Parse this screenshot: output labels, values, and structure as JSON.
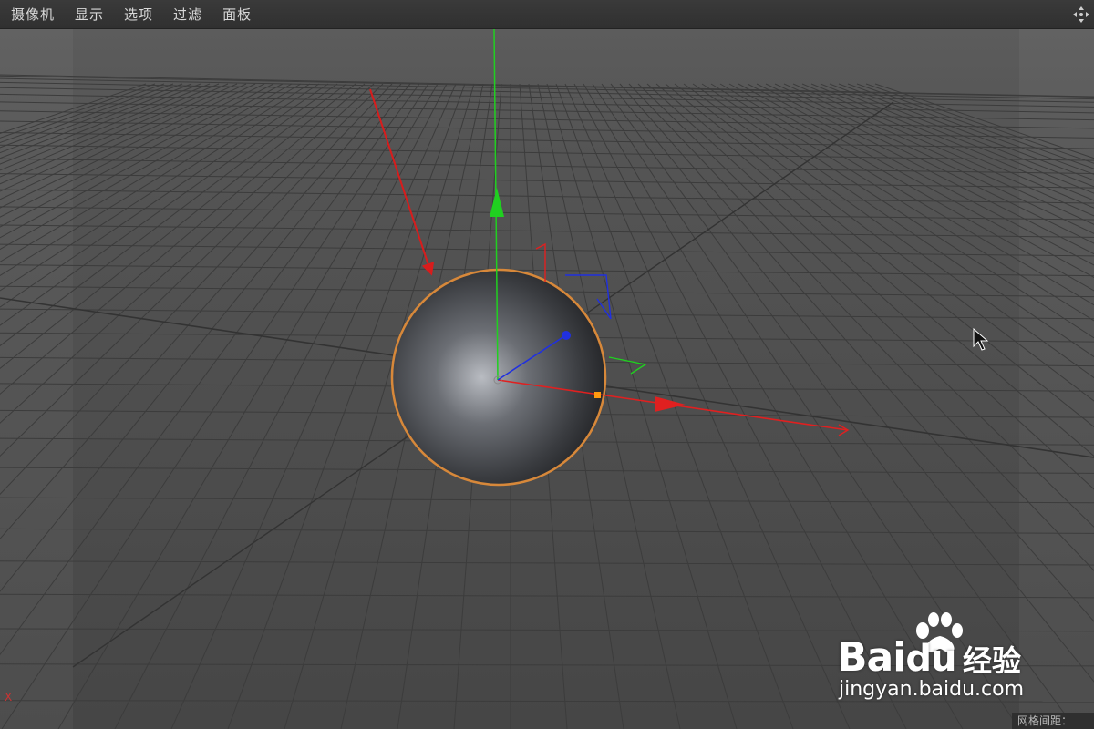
{
  "menubar": {
    "items": [
      {
        "label": "摄像机"
      },
      {
        "label": "显示"
      },
      {
        "label": "选项"
      },
      {
        "label": "过滤"
      },
      {
        "label": "面板"
      }
    ],
    "nav_icon": "move-view-icon"
  },
  "viewport": {
    "object": "sphere",
    "axes": {
      "x_color": "#e02020",
      "y_color": "#20d020",
      "z_color": "#2020e0"
    },
    "selection_outline_color": "#d7883a",
    "annotation_arrow_color": "#d81c1c"
  },
  "status": {
    "grid_spacing_label": "网格间距：",
    "axis_corner": "X"
  },
  "watermark": {
    "brand_bai": "Bai",
    "brand_du": "du",
    "brand_cn": "经验",
    "url": "jingyan.baidu.com"
  }
}
